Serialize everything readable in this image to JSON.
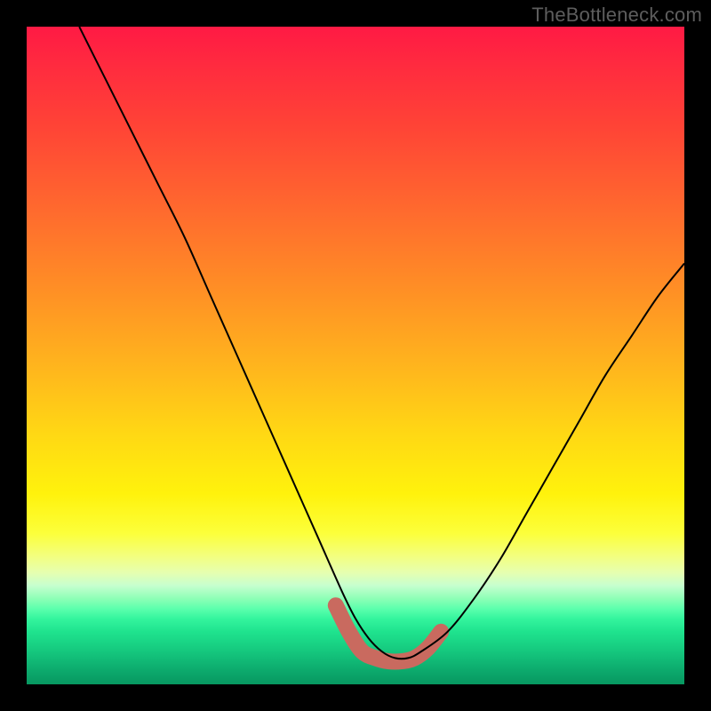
{
  "watermark": "TheBottleneck.com",
  "chart_data": {
    "type": "line",
    "title": "",
    "xlabel": "",
    "ylabel": "",
    "xlim": [
      0,
      100
    ],
    "ylim": [
      0,
      100
    ],
    "background_gradient_stops": [
      {
        "pos": 0,
        "color": "#ff1a44"
      },
      {
        "pos": 15,
        "color": "#ff4336"
      },
      {
        "pos": 40,
        "color": "#ff8f25"
      },
      {
        "pos": 62,
        "color": "#ffd814"
      },
      {
        "pos": 80,
        "color": "#f3ff7f"
      },
      {
        "pos": 88,
        "color": "#5cffad"
      },
      {
        "pos": 100,
        "color": "#079760"
      }
    ],
    "series": [
      {
        "name": "bottleneck-curve",
        "color": "#000000",
        "x": [
          8,
          12,
          16,
          20,
          24,
          28,
          32,
          36,
          40,
          44,
          48,
          50,
          52,
          54,
          56,
          58,
          60,
          64,
          68,
          72,
          76,
          80,
          84,
          88,
          92,
          96,
          100
        ],
        "y": [
          100,
          92,
          84,
          76,
          68,
          59,
          50,
          41,
          32,
          23,
          14,
          10,
          7,
          5,
          4,
          4,
          5,
          8,
          13,
          19,
          26,
          33,
          40,
          47,
          53,
          59,
          64
        ]
      },
      {
        "name": "optimal-band",
        "color": "#c96a5f",
        "x": [
          47,
          49,
          51,
          53,
          55,
          57,
          59,
          61,
          63
        ],
        "y": [
          12,
          8,
          5,
          4,
          3.5,
          3.5,
          4,
          5.5,
          8
        ]
      }
    ]
  }
}
